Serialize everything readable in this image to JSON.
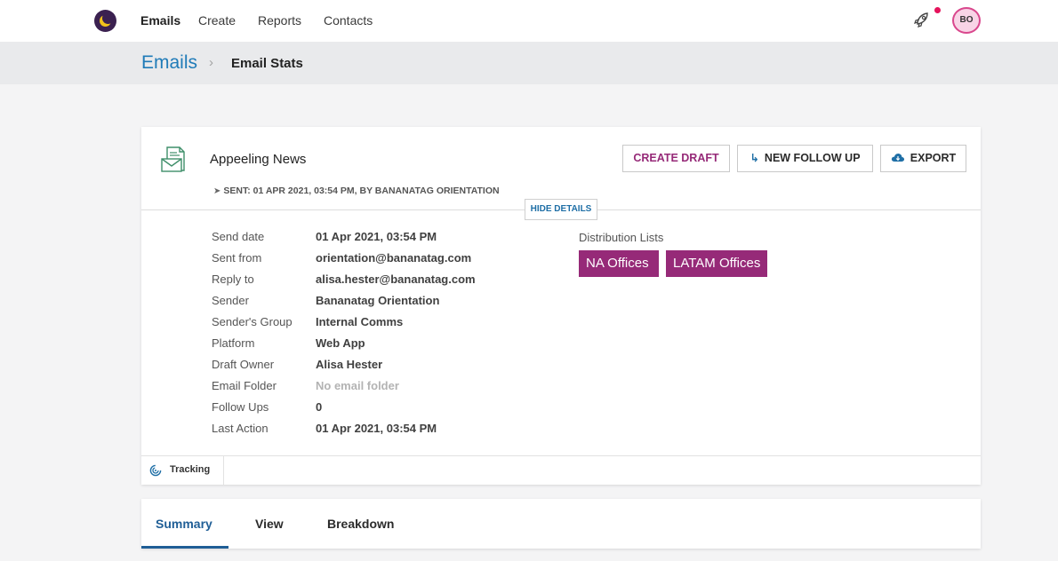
{
  "nav": {
    "items": [
      {
        "label": "Emails",
        "active": true
      },
      {
        "label": "Create",
        "active": false
      },
      {
        "label": "Reports",
        "active": false
      },
      {
        "label": "Contacts",
        "active": false
      }
    ],
    "avatar_initials": "BO",
    "notification_dot_color": "#e5135c"
  },
  "breadcrumb": {
    "parent": "Emails",
    "separator": "›",
    "current": "Email Stats"
  },
  "email": {
    "title": "Appeeling News",
    "sent_line": "SENT: 01 APR 2021, 03:54 PM, BY BANANATAG ORIENTATION",
    "buttons": {
      "create_draft": "CREATE DRAFT",
      "new_follow_up": "NEW FOLLOW UP",
      "export": "EXPORT"
    },
    "hide_details": "HIDE DETAILS",
    "details": [
      {
        "label": "Send date",
        "value": "01 Apr 2021, 03:54 PM"
      },
      {
        "label": "Sent from",
        "value": "orientation@bananatag.com"
      },
      {
        "label": "Reply to",
        "value": "alisa.hester@bananatag.com"
      },
      {
        "label": "Sender",
        "value": "Bananatag Orientation"
      },
      {
        "label": "Sender's Group",
        "value": "Internal Comms"
      },
      {
        "label": "Platform",
        "value": "Web App"
      },
      {
        "label": "Draft Owner",
        "value": "Alisa Hester"
      },
      {
        "label": "Email Folder",
        "value": "No email folder"
      },
      {
        "label": "Follow Ups",
        "value": "0"
      },
      {
        "label": "Last Action",
        "value": "01 Apr 2021, 03:54 PM"
      }
    ],
    "distribution_label": "Distribution Lists",
    "distribution_lists": [
      "NA Offices",
      "LATAM Offices"
    ],
    "tracking_tab": "Tracking"
  },
  "tabs": [
    {
      "label": "Summary",
      "active": true
    },
    {
      "label": "View",
      "active": false
    },
    {
      "label": "Breakdown",
      "active": false
    }
  ],
  "colors": {
    "brand_purple": "#962a78",
    "link_blue": "#1f7bb8",
    "active_tab_blue": "#1f5e96"
  }
}
